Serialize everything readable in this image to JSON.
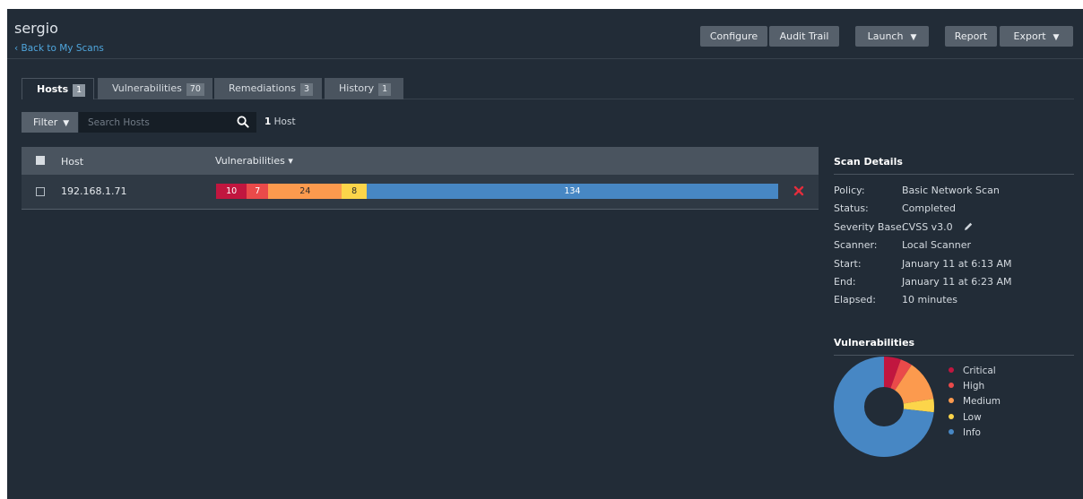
{
  "header": {
    "scan_name": "sergio",
    "back_link": "‹ Back to My Scans"
  },
  "toolbar": {
    "configure": "Configure",
    "audit_trail": "Audit Trail",
    "launch": "Launch",
    "report": "Report",
    "export": "Export"
  },
  "tabs": [
    {
      "label": "Hosts",
      "count": "1",
      "active": true
    },
    {
      "label": "Vulnerabilities",
      "count": "70",
      "active": false
    },
    {
      "label": "Remediations",
      "count": "3",
      "active": false
    },
    {
      "label": "History",
      "count": "1",
      "active": false
    }
  ],
  "filter": {
    "label": "Filter",
    "search_placeholder": "Search Hosts",
    "result_count": "1",
    "result_unit": "Host"
  },
  "table": {
    "columns": {
      "host": "Host",
      "vulnerabilities": "Vulnerabilities ▾"
    },
    "rows": [
      {
        "host": "192.168.1.71",
        "severity": [
          {
            "name": "critical",
            "label": "10",
            "value": 10
          },
          {
            "name": "high",
            "label": "7",
            "value": 7
          },
          {
            "name": "medium",
            "label": "24",
            "value": 24
          },
          {
            "name": "low",
            "label": "8",
            "value": 8
          },
          {
            "name": "info",
            "label": "134",
            "value": 134
          }
        ]
      }
    ]
  },
  "scan_details": {
    "title": "Scan Details",
    "items": [
      {
        "label": "Policy:",
        "value": "Basic Network Scan"
      },
      {
        "label": "Status:",
        "value": "Completed"
      },
      {
        "label": "Severity Base:",
        "value": "CVSS v3.0"
      },
      {
        "label": "Scanner:",
        "value": "Local Scanner"
      },
      {
        "label": "Start:",
        "value": "January 11 at 6:13 AM"
      },
      {
        "label": "End:",
        "value": "January 11 at 6:23 AM"
      },
      {
        "label": "Elapsed:",
        "value": "10 minutes"
      }
    ]
  },
  "vulnerabilities_chart": {
    "title": "Vulnerabilities",
    "legend": [
      "Critical",
      "High",
      "Medium",
      "Low",
      "Info"
    ]
  },
  "chart_data": {
    "type": "pie",
    "categories": [
      "Critical",
      "High",
      "Medium",
      "Low",
      "Info"
    ],
    "values": [
      10,
      7,
      24,
      8,
      134
    ],
    "colors": [
      "#c1163f",
      "#ea4a4a",
      "#fc9a4e",
      "#fcd54a",
      "#4787c4"
    ]
  },
  "colors": {
    "background": "#222c37",
    "accent_link": "#4fa6dd",
    "remove": "#e32d3c"
  },
  "icons": {
    "filter_caret": "caret-down-icon",
    "search": "search-icon",
    "remove": "close-icon",
    "edit": "pencil-icon"
  }
}
